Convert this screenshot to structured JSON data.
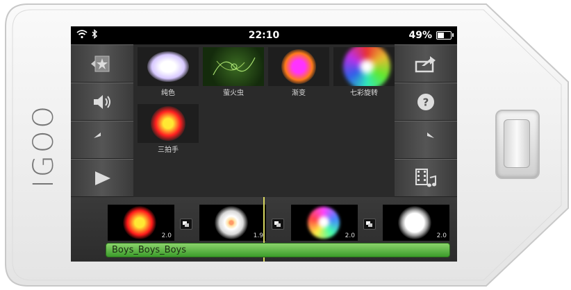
{
  "device": {
    "brand": "IGOO",
    "body_color": "#f2f2f2",
    "hardware_button": "home-button"
  },
  "status_bar": {
    "time": "22:10",
    "battery": "49%",
    "battery_level": 0.49,
    "icons": [
      "wifi-icon",
      "bluetooth-icon",
      "battery-icon"
    ]
  },
  "left_toolbar": {
    "items": [
      {
        "name": "effect-library-icon"
      },
      {
        "name": "sound-icon"
      },
      {
        "name": "undo-icon"
      },
      {
        "name": "play-icon"
      }
    ]
  },
  "right_toolbar": {
    "items": [
      {
        "name": "share-icon"
      },
      {
        "name": "help-icon"
      },
      {
        "name": "redo-icon"
      },
      {
        "name": "film-music-icon"
      }
    ]
  },
  "effects": [
    {
      "label": "纯色",
      "colors": [
        "#ffffff",
        "#d7c8ff"
      ]
    },
    {
      "label": "萤火虫",
      "colors": [
        "#6fbf3a",
        "#1a3a10"
      ]
    },
    {
      "label": "渐变",
      "colors": [
        "#ff33ff",
        "#ff7a1a"
      ]
    },
    {
      "label": "七彩旋转",
      "colors": [
        "#ff3333",
        "#3366ff"
      ]
    },
    {
      "label": "三拍手",
      "colors": [
        "#ffe833",
        "#ff2020"
      ]
    }
  ],
  "timeline": {
    "clips": [
      {
        "duration": "2.0",
        "colors": [
          "#ffe833",
          "#ff1a1a"
        ]
      },
      {
        "duration": "1.9",
        "colors": [
          "#ffcc66",
          "#ffffff"
        ]
      },
      {
        "duration": "2.0",
        "colors": [
          "#ff44ff",
          "#44aaff"
        ]
      },
      {
        "duration": "2.0",
        "colors": [
          "#ffffff",
          "#ffffff"
        ]
      }
    ],
    "track_label": "Boys_Boys_Boys",
    "track_color": "#5fb544",
    "playhead_color": "#d8d860"
  }
}
